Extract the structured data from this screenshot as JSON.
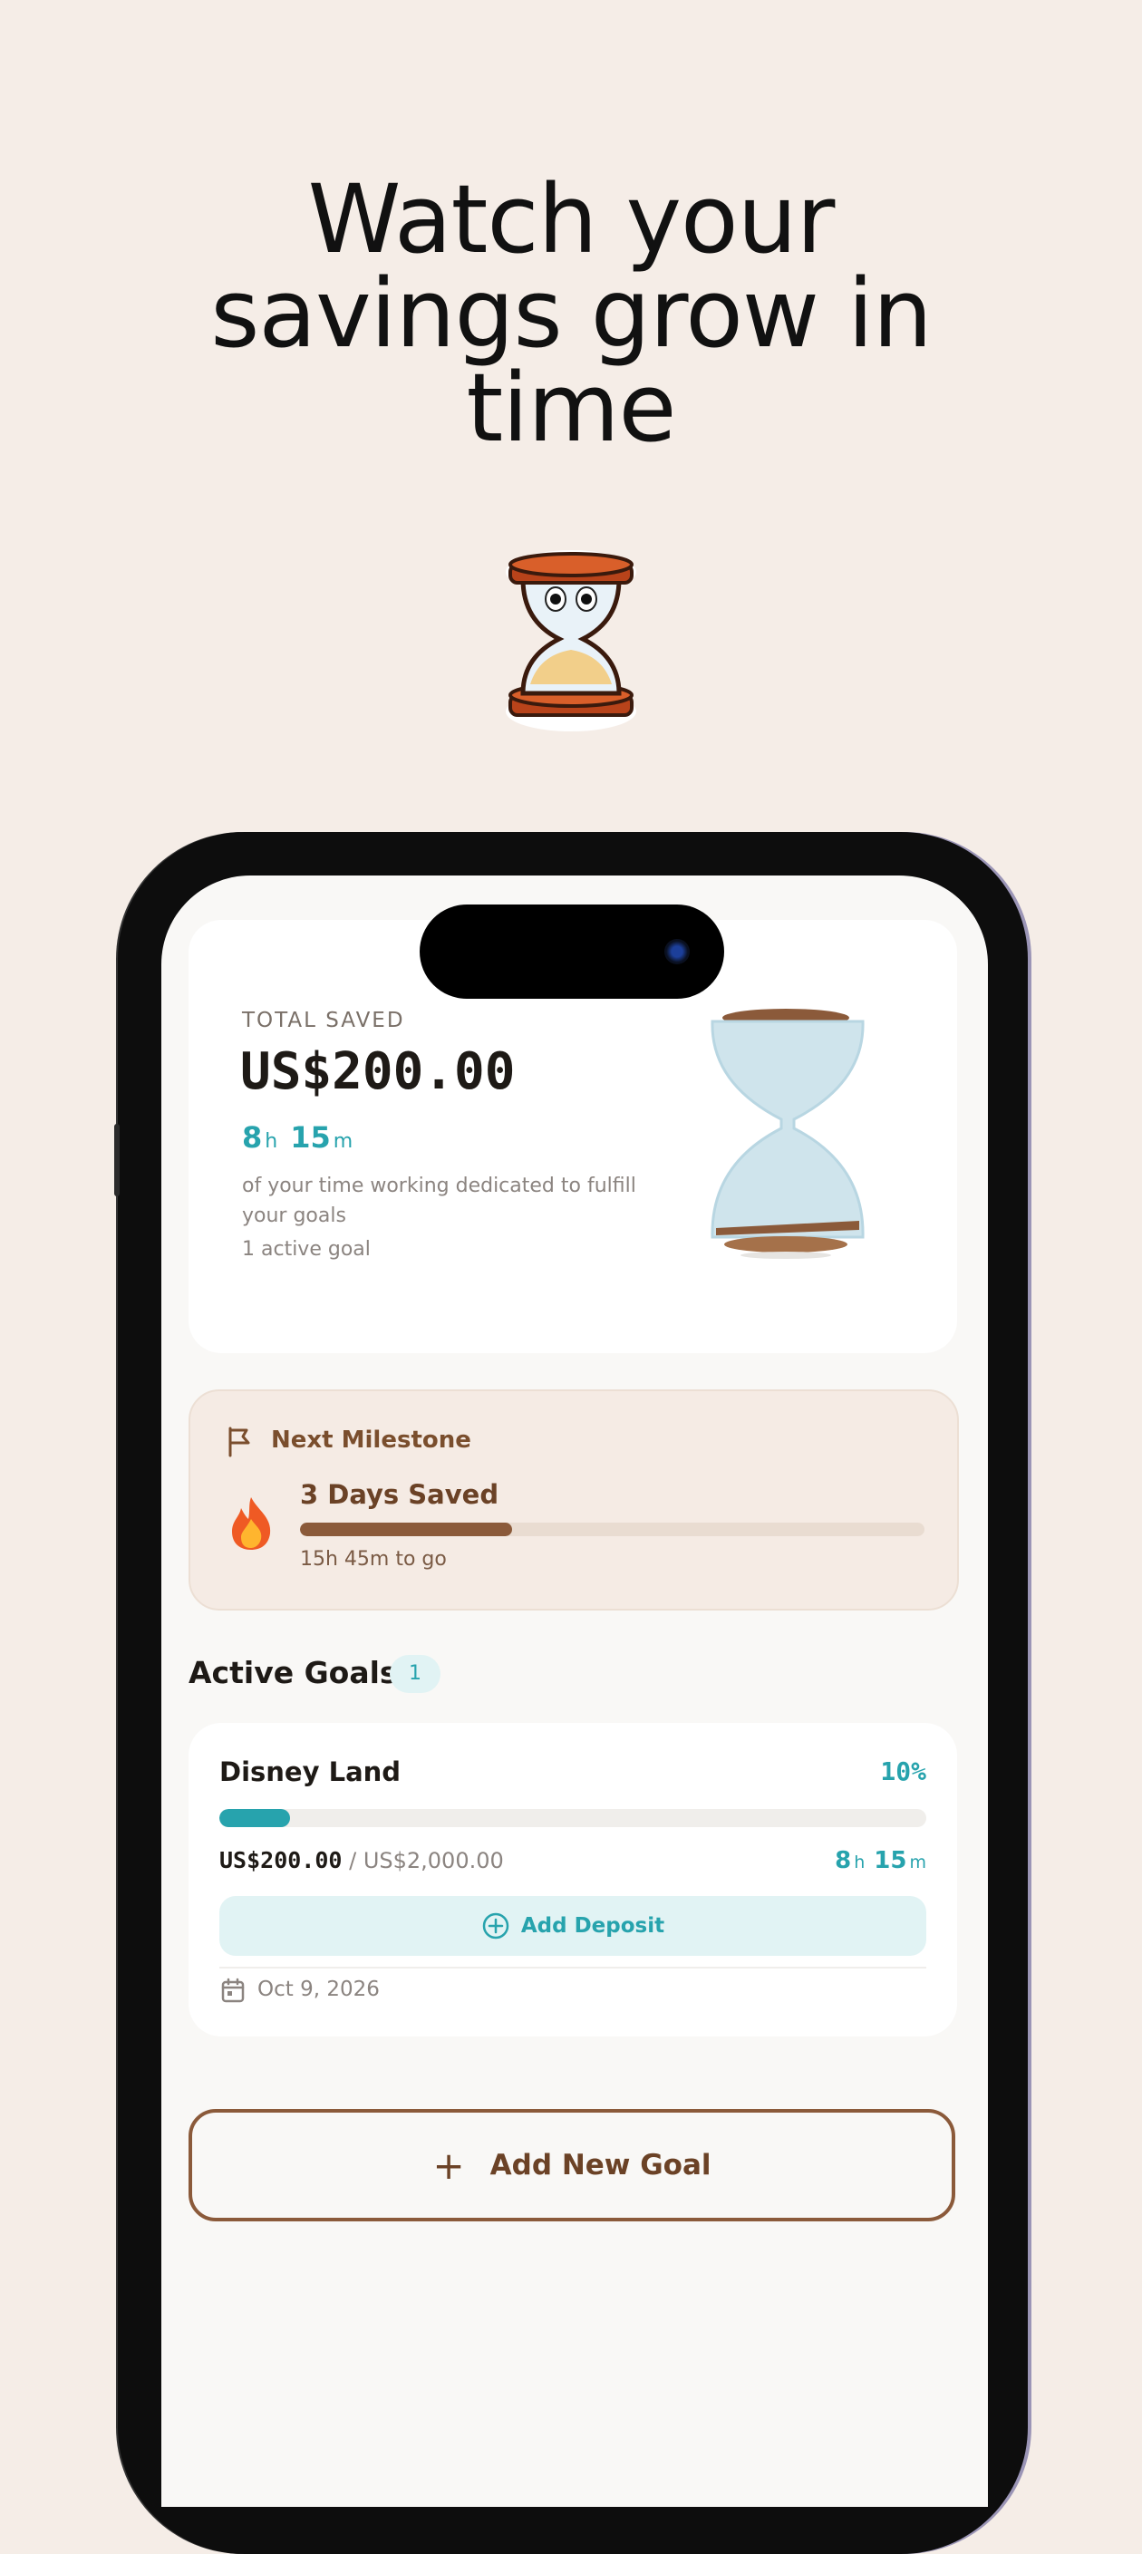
{
  "headline": {
    "line1": "Watch your",
    "line2": "savings grow in",
    "line3": "time"
  },
  "summary": {
    "label": "TOTAL SAVED",
    "amount": "US$200.00",
    "hours": "8",
    "hours_unit": "h",
    "minutes": "15",
    "minutes_unit": "m",
    "description": "of your time working dedicated to fulfill your goals",
    "active_count": "1 active goal"
  },
  "milestone": {
    "title": "Next Milestone",
    "name": "3 Days Saved",
    "progress": 0.34,
    "remaining": "15h 45m to go"
  },
  "active_goals": {
    "title": "Active Goals",
    "count": "1",
    "goals": [
      {
        "name": "Disney Land",
        "percent": "10%",
        "progress": 0.1,
        "saved": "US$200.00",
        "target": " / US$2,000.00",
        "hours": "8",
        "hours_unit": "h",
        "minutes": "15",
        "minutes_unit": "m",
        "deposit_label": "Add Deposit",
        "date": "Oct 9, 2026"
      }
    ]
  },
  "add_goal_label": "Add New Goal",
  "colors": {
    "accent": "#27a3ad",
    "brown": "#8b5a3a",
    "background": "#f5ede7"
  }
}
